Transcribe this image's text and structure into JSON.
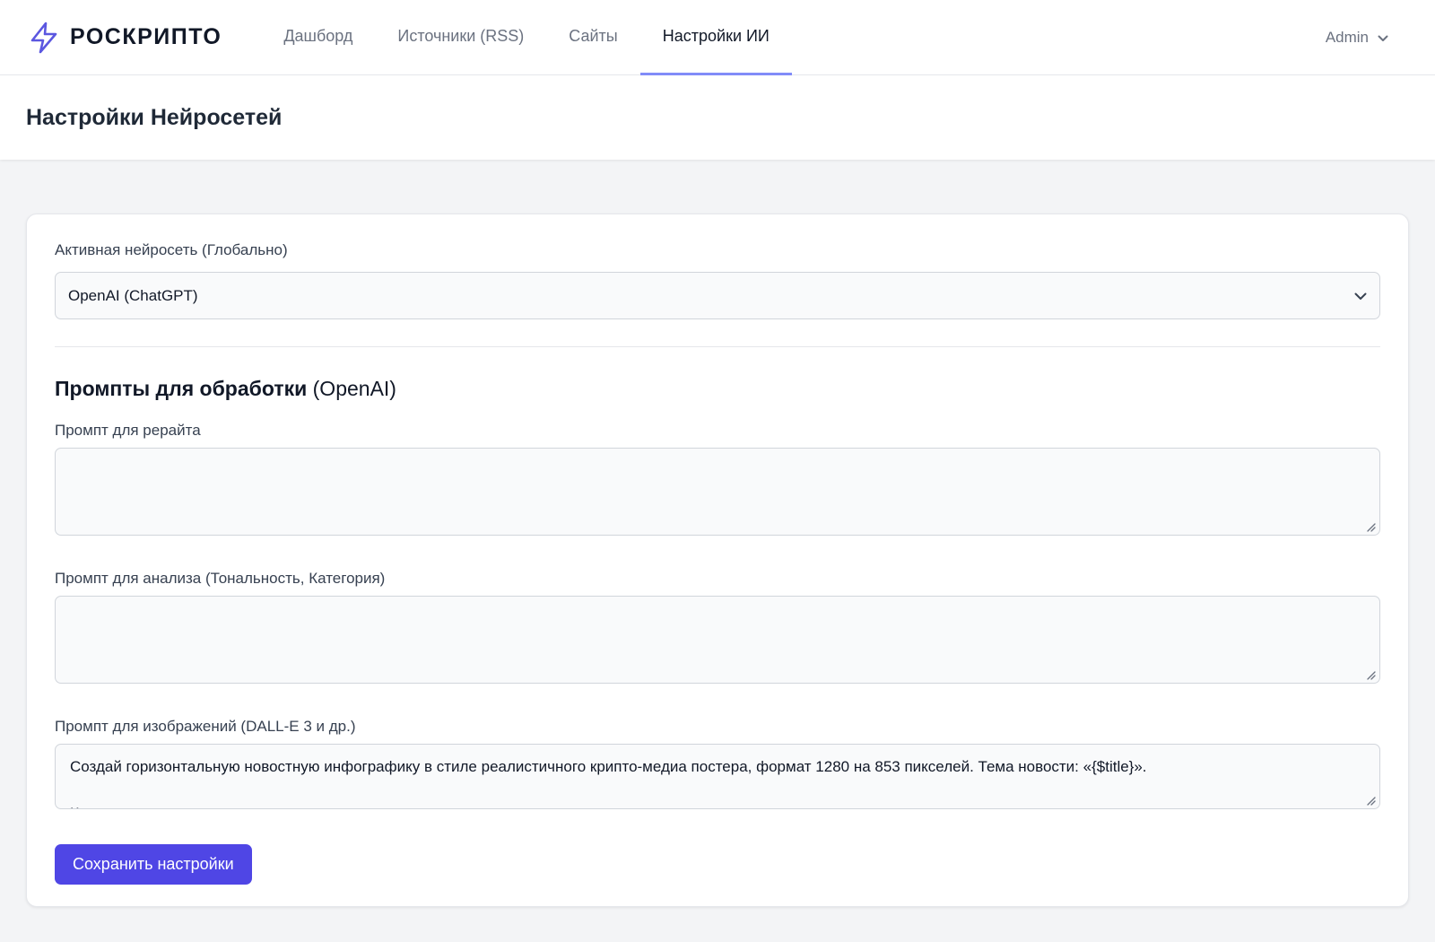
{
  "nav": {
    "brand": "РОСКРИПТО",
    "links": [
      "Дашборд",
      "Источники (RSS)",
      "Сайты",
      "Настройки ИИ"
    ],
    "user": "Admin"
  },
  "header": {
    "title": "Настройки Нейросетей"
  },
  "form": {
    "active_label": "Активная нейросеть (Глобально)",
    "active_value": "OpenAI (ChatGPT)",
    "section_title": "Промпты для обработки",
    "section_suffix": "(OpenAI)",
    "rewrite_label": "Промпт для рерайта",
    "rewrite_value": "",
    "analysis_label": "Промпт для анализа (Тональность, Категория)",
    "analysis_value": "",
    "image_label": "Промпт для изображений (DALL-E 3 и др.)",
    "image_value": "Создай горизонтальную новостную инфографику в стиле реалистичного крипто-медиа постера, формат 1280 на 853 пикселей. Тема новости: «{$title}».\n\nКомпозиция:",
    "save_label": "Сохранить настройки"
  },
  "colors": {
    "accent": "#4f46e5",
    "active_tab_underline": "#818cf8",
    "background": "#f3f4f6"
  },
  "icons": {
    "brand": "lightning-bolt-icon",
    "user_chevron": "chevron-down-icon",
    "select_chevron": "chevron-down-icon",
    "resize": "resize-handle-icon"
  }
}
